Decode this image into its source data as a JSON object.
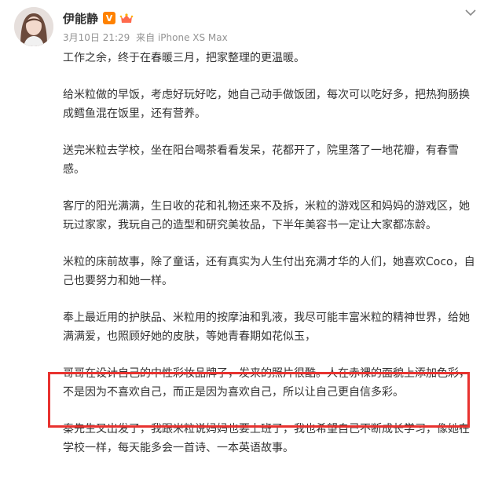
{
  "post": {
    "author": "伊能静",
    "verified_badge": "V",
    "timestamp": "3月10日 21:29",
    "source": "来自 iPhone XS Max",
    "paragraphs": [
      "工作之余，终于在春暖三月，把家整理的更温暖。",
      "给米粒做的早饭，考虑好玩好吃，她自己动手做饭团，每次可以吃好多，把热狗肠换成鳕鱼混在饭里，还有营养。",
      "送完米粒去学校，坐在阳台喝茶看看发呆，花都开了，院里落了一地花瓣，有春雪感。",
      "客厅的阳光满满，生日收的花和礼物还来不及拆，米粒的游戏区和妈妈的游戏区，她玩过家家，我玩自己的造型和研究美妆品，下半年美容书一定让大家都冻龄。",
      "米粒的床前故事，除了童话，还有真实为人生付出充满才华的人们，她喜欢Coco，自己也要努力和她一样。",
      "奉上最近用的护肤品、米粒用的按摩油和乳液，我尽可能丰富米粒的精神世界，给她满满爱，也照顾好她的皮肤，等她青春期如花似玉，",
      "哥哥在设计自己的中性彩妆品牌了，发来的照片很酷。人在赤裸的面貌上添加色彩，不是因为不喜欢自己，而正是因为喜欢自己，所以让自己更自信多彩。",
      "秦先生又出发了，我跟米粒说妈妈也要上班了，我也希望自己不断成长学习，像她在学校一样，每天能多会一首诗、一本英语故事。"
    ]
  },
  "icons": {
    "verified": "verified-v-icon",
    "member": "crown-member-icon",
    "more": "chevron-down-icon"
  },
  "colors": {
    "highlight_border": "#e8322f",
    "meta_text": "#939393",
    "verified_badge": "#ff8200"
  }
}
